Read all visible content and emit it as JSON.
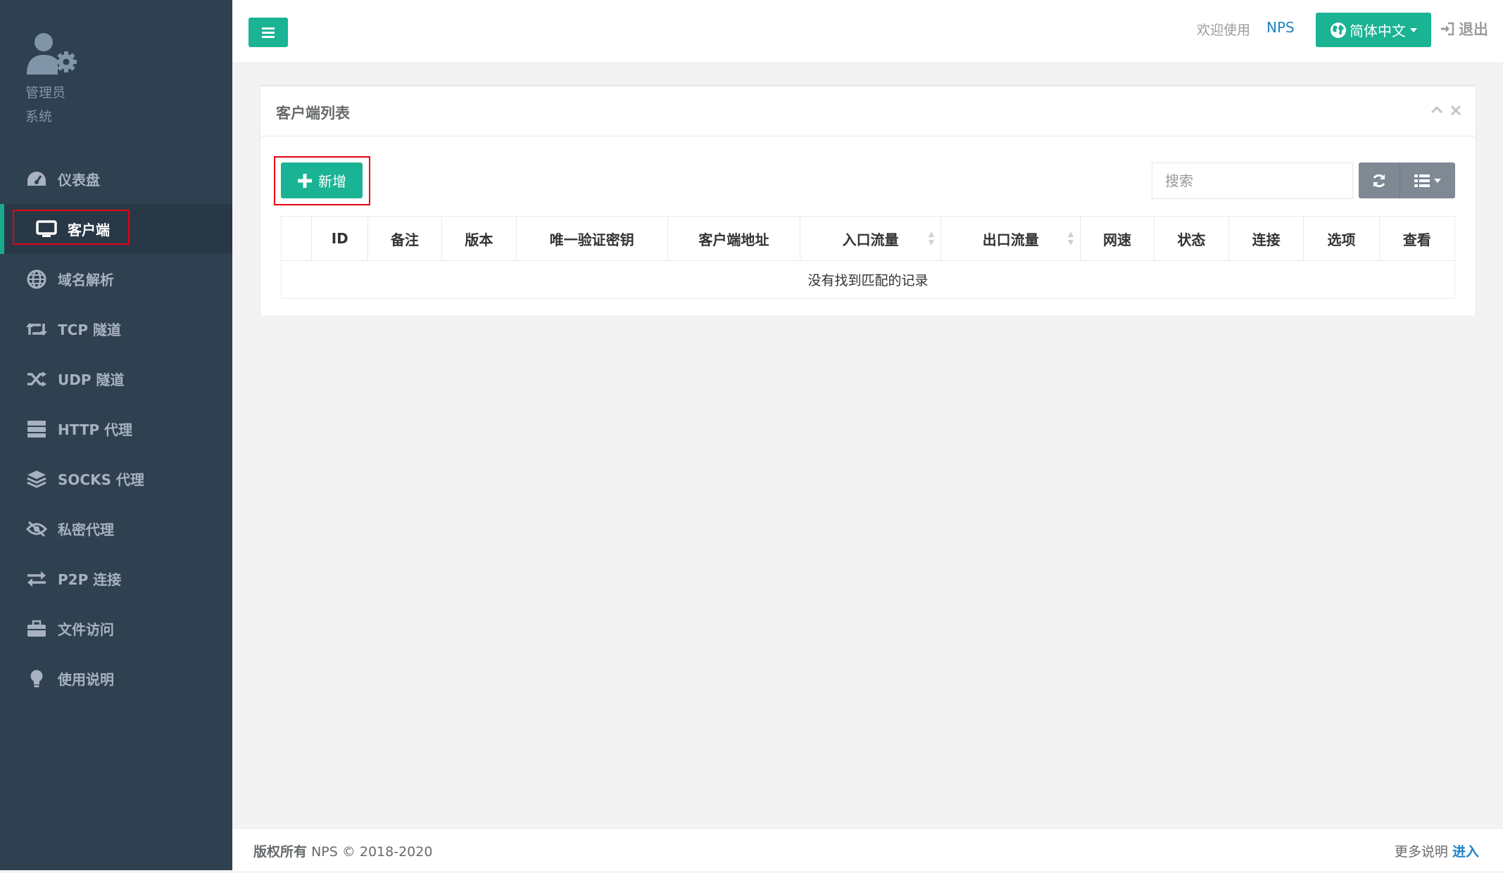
{
  "sidebar": {
    "profile": {
      "name": "管理员",
      "role": "系统"
    },
    "items": [
      {
        "label": "仪表盘",
        "icon": "dashboard-icon"
      },
      {
        "label": "客户端",
        "icon": "monitor-icon",
        "active": true
      },
      {
        "label": "域名解析",
        "icon": "globe-icon"
      },
      {
        "label": "TCP 隧道",
        "icon": "retweet-icon"
      },
      {
        "label": "UDP 隧道",
        "icon": "random-icon"
      },
      {
        "label": "HTTP 代理",
        "icon": "server-icon"
      },
      {
        "label": "SOCKS 代理",
        "icon": "layers-icon"
      },
      {
        "label": "私密代理",
        "icon": "eye-slash-icon"
      },
      {
        "label": "P2P 连接",
        "icon": "exchange-icon"
      },
      {
        "label": "文件访问",
        "icon": "briefcase-icon"
      },
      {
        "label": "使用说明",
        "icon": "lightbulb-icon"
      }
    ]
  },
  "topbar": {
    "welcome": "欢迎使用",
    "brand": "NPS",
    "language": "简体中文",
    "logout": "退出"
  },
  "panel": {
    "title": "客户端列表",
    "add_label": "新增",
    "search_placeholder": "搜索",
    "columns": [
      "",
      "ID",
      "备注",
      "版本",
      "唯一验证密钥",
      "客户端地址",
      "入口流量",
      "出口流量",
      "网速",
      "状态",
      "连接",
      "选项",
      "查看"
    ],
    "empty_text": "没有找到匹配的记录"
  },
  "footer": {
    "copyright_bold": "版权所有",
    "copyright_text": "NPS © 2018-2020",
    "more_text": "更多说明",
    "more_link": "进入"
  },
  "colors": {
    "sidebar": "#2f4050",
    "accent": "#1ab394",
    "link": "#1c84c6",
    "highlight": "#e60012"
  }
}
